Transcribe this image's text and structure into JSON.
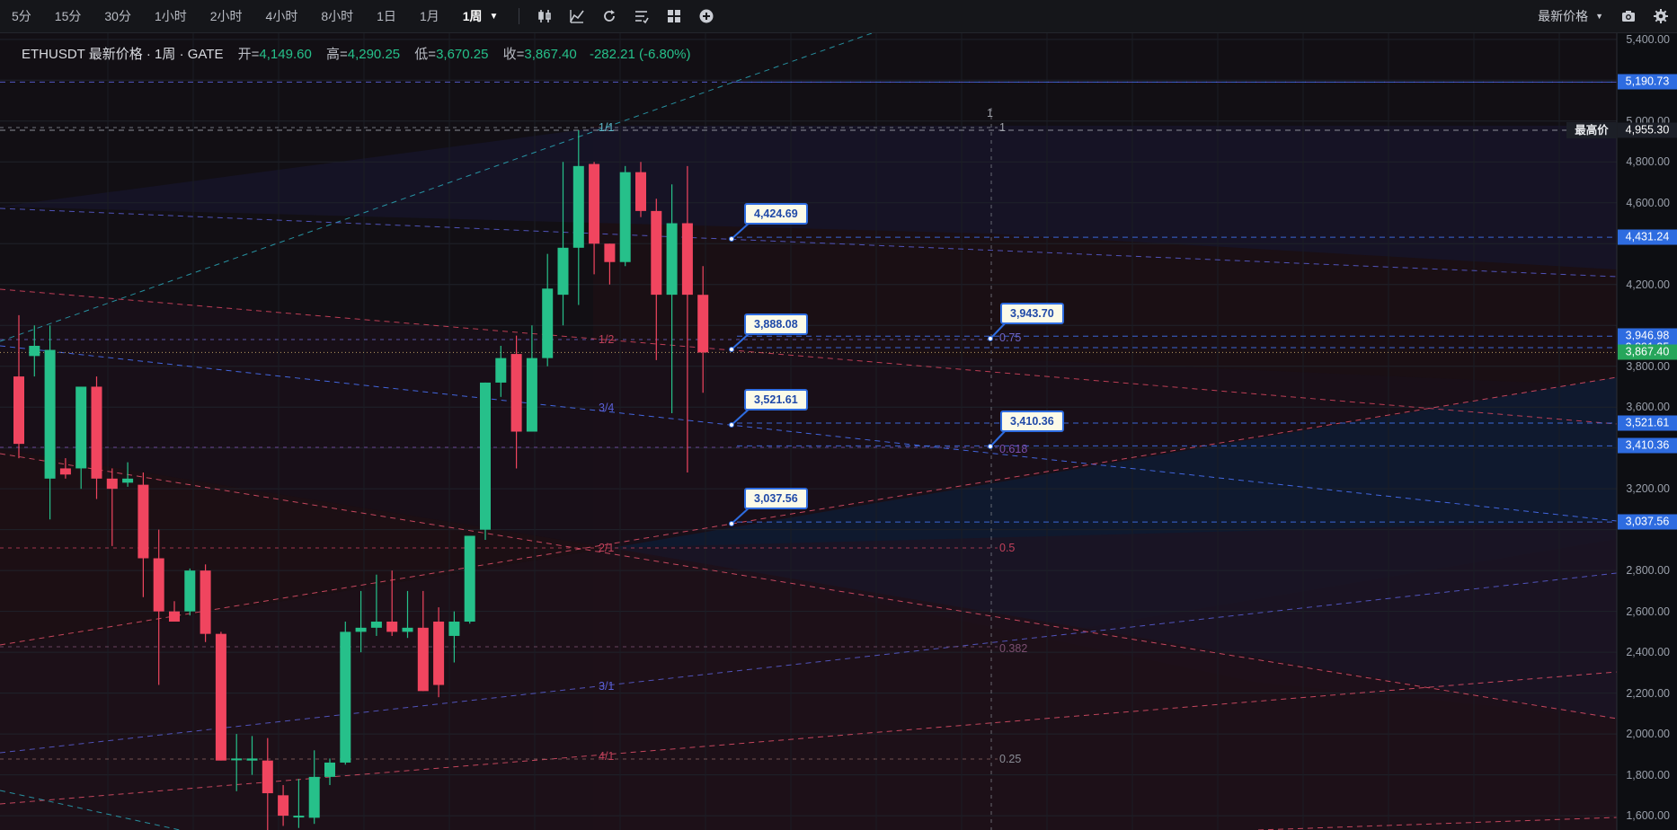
{
  "toolbar": {
    "timeframes": [
      "5分",
      "15分",
      "30分",
      "1小时",
      "2小时",
      "4小时",
      "8小时",
      "1日",
      "1月",
      "1周"
    ],
    "active_timeframe": "1周",
    "tools": [
      "candle-type-icon",
      "indicators-icon",
      "replay-icon",
      "drawing-list-icon",
      "layout-icon",
      "add-icon"
    ],
    "price_type": "最新价格",
    "right_icons": [
      "camera-icon",
      "settings-icon"
    ]
  },
  "legend": {
    "symbol": "ETHUSDT 最新价格 · 1周 · GATE",
    "open_label": "开=",
    "open": "4,149.60",
    "high_label": "高=",
    "high": "4,290.25",
    "low_label": "低=",
    "low": "3,670.25",
    "close_label": "收=",
    "close": "3,867.40",
    "change": "-282.21 (-6.80%)"
  },
  "colors": {
    "up": "#26c08a",
    "down": "#f0455f",
    "accent": "#2e6ce0",
    "background": "#0d0e12",
    "last_price": "#26a65b"
  },
  "axis": {
    "tick_labels": [
      "5,400.00",
      "5,000.00",
      "4,800.00",
      "4,600.00",
      "4,200.00",
      "3,800.00",
      "3,600.00",
      "3,200.00",
      "2,800.00",
      "2,600.00",
      "2,400.00",
      "2,200.00",
      "2,000.00",
      "1,800.00",
      "1,600.00"
    ],
    "price_tags": [
      {
        "value": "5,190.73",
        "kind": "blue"
      },
      {
        "value": "4,955.30",
        "kind": "dark"
      },
      {
        "value": "4,431.24",
        "kind": "blue"
      },
      {
        "value": "3,946.98",
        "kind": "blue"
      },
      {
        "value": "3,891.35",
        "kind": "blue"
      },
      {
        "value": "3,867.40",
        "kind": "green"
      },
      {
        "value": "3,521.61",
        "kind": "blue"
      },
      {
        "value": "3,410.36",
        "kind": "blue"
      },
      {
        "value": "3,037.56",
        "kind": "blue"
      }
    ],
    "high_label": "最高价"
  },
  "callouts": [
    "4,424.69",
    "3,888.08",
    "3,521.61",
    "3,037.56",
    "3,943.70",
    "3,410.36"
  ],
  "fib": {
    "levels": [
      "1",
      "0.75",
      "0.618",
      "0.5",
      "0.382",
      "0.25"
    ],
    "top_marker": "1"
  },
  "gann_fan": {
    "labels": [
      "1/1",
      "1/2",
      "2/1",
      "3/4",
      "3/1",
      "4/1"
    ]
  },
  "chart_data": {
    "type": "candlestick",
    "symbol": "ETHUSDT",
    "interval": "1周",
    "exchange": "GATE",
    "ylim": [
      1530,
      5430
    ],
    "candles": [
      {
        "o": 3750,
        "h": 4050,
        "l": 3350,
        "c": 3420
      },
      {
        "o": 3850,
        "h": 4000,
        "l": 3750,
        "c": 3900
      },
      {
        "o": 3250,
        "h": 4000,
        "l": 3050,
        "c": 3880
      },
      {
        "o": 3300,
        "h": 3350,
        "l": 3250,
        "c": 3270
      },
      {
        "o": 3300,
        "h": 3700,
        "l": 3200,
        "c": 3700
      },
      {
        "o": 3700,
        "h": 3750,
        "l": 3150,
        "c": 3250
      },
      {
        "o": 3250,
        "h": 3300,
        "l": 2920,
        "c": 3200
      },
      {
        "o": 3230,
        "h": 3330,
        "l": 3210,
        "c": 3250
      },
      {
        "o": 3220,
        "h": 3280,
        "l": 2670,
        "c": 2860
      },
      {
        "o": 2860,
        "h": 3000,
        "l": 2240,
        "c": 2600
      },
      {
        "o": 2600,
        "h": 2650,
        "l": 2550,
        "c": 2550
      },
      {
        "o": 2600,
        "h": 2810,
        "l": 2580,
        "c": 2800
      },
      {
        "o": 2800,
        "h": 2830,
        "l": 2450,
        "c": 2490
      },
      {
        "o": 2490,
        "h": 2500,
        "l": 2050,
        "c": 1870
      },
      {
        "o": 1880,
        "h": 2000,
        "l": 1720,
        "c": 1880
      },
      {
        "o": 1870,
        "h": 1990,
        "l": 1800,
        "c": 1880
      },
      {
        "o": 1870,
        "h": 1980,
        "l": 1520,
        "c": 1710
      },
      {
        "o": 1700,
        "h": 1750,
        "l": 1550,
        "c": 1600
      },
      {
        "o": 1600,
        "h": 1780,
        "l": 1540,
        "c": 1600
      },
      {
        "o": 1590,
        "h": 1920,
        "l": 1560,
        "c": 1790
      },
      {
        "o": 1790,
        "h": 1880,
        "l": 1750,
        "c": 1860
      },
      {
        "o": 1860,
        "h": 2550,
        "l": 1850,
        "c": 2500
      },
      {
        "o": 2500,
        "h": 2700,
        "l": 2400,
        "c": 2520
      },
      {
        "o": 2520,
        "h": 2780,
        "l": 2480,
        "c": 2550
      },
      {
        "o": 2550,
        "h": 2800,
        "l": 2480,
        "c": 2500
      },
      {
        "o": 2500,
        "h": 2700,
        "l": 2470,
        "c": 2520
      },
      {
        "o": 2520,
        "h": 2700,
        "l": 2320,
        "c": 2210
      },
      {
        "o": 2550,
        "h": 2620,
        "l": 2180,
        "c": 2240
      },
      {
        "o": 2480,
        "h": 2600,
        "l": 2350,
        "c": 2550
      },
      {
        "o": 2550,
        "h": 2900,
        "l": 2540,
        "c": 2970
      },
      {
        "o": 3000,
        "h": 3680,
        "l": 2950,
        "c": 3720
      },
      {
        "o": 3720,
        "h": 3900,
        "l": 3650,
        "c": 3840
      },
      {
        "o": 3860,
        "h": 3950,
        "l": 3300,
        "c": 3480
      },
      {
        "o": 3480,
        "h": 4000,
        "l": 3500,
        "c": 3840
      },
      {
        "o": 3840,
        "h": 4350,
        "l": 3800,
        "c": 4180
      },
      {
        "o": 4150,
        "h": 4800,
        "l": 4000,
        "c": 4380
      },
      {
        "o": 4380,
        "h": 4955,
        "l": 4100,
        "c": 4780
      },
      {
        "o": 4790,
        "h": 4800,
        "l": 4250,
        "c": 4400
      },
      {
        "o": 4400,
        "h": 4350,
        "l": 4200,
        "c": 4310
      },
      {
        "o": 4310,
        "h": 4780,
        "l": 4290,
        "c": 4750
      },
      {
        "o": 4750,
        "h": 4800,
        "l": 4530,
        "c": 4560
      },
      {
        "o": 4560,
        "h": 4620,
        "l": 3830,
        "c": 4150
      },
      {
        "o": 4150,
        "h": 4690,
        "l": 3570,
        "c": 4500
      },
      {
        "o": 4500,
        "h": 4780,
        "l": 3280,
        "c": 4150
      },
      {
        "o": 4149.6,
        "h": 4290.25,
        "l": 3670.25,
        "c": 3867.4
      }
    ],
    "drawn_price_levels": [
      5190.73,
      4955.3,
      4431.24,
      3946.98,
      3891.35,
      3867.4,
      3521.61,
      3410.36,
      3037.56
    ],
    "last_price": 3867.4
  }
}
